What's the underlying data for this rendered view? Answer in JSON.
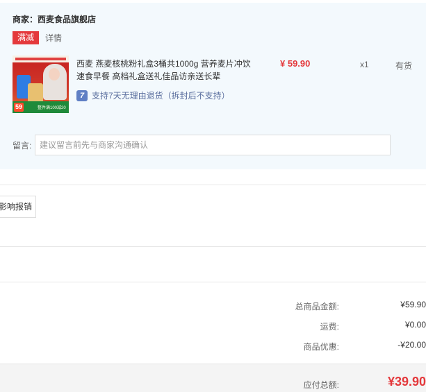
{
  "shop": {
    "name_label": "商家：西麦食品旗舰店"
  },
  "promo": {
    "tag": "满减",
    "detail": "详情"
  },
  "product": {
    "title": "西麦 燕麦核桃粉礼盒3桶共1000g 营养麦片冲饮速食早餐 高档礼盒送礼佳品访亲送长辈",
    "price": "¥ 59.90",
    "qty": "x1",
    "stock": "有货",
    "return_icon": "7",
    "return_policy": "支持7天无理由退货（拆封后不支持）",
    "image": {
      "price_badge": "59",
      "banner_text": "整件满100减20"
    }
  },
  "remark": {
    "label": "留言:",
    "placeholder": "建议留言前先与商家沟通确认"
  },
  "invoice": {
    "button_label": "影响报销"
  },
  "summary": {
    "items": [
      {
        "label": "总商品金额:",
        "value": "¥59.90"
      },
      {
        "label": "运费:",
        "value": "¥0.00"
      },
      {
        "label": "商品优惠:",
        "value": "-¥20.00"
      }
    ],
    "payable_label": "应付总额:",
    "payable_value": "¥39.90"
  },
  "colors": {
    "accent_red": "#e4393c",
    "panel_bg": "#f3f9fd",
    "return_blue": "#5f7fc4"
  },
  "icons": {
    "return_policy": "seven-day-return-icon"
  }
}
